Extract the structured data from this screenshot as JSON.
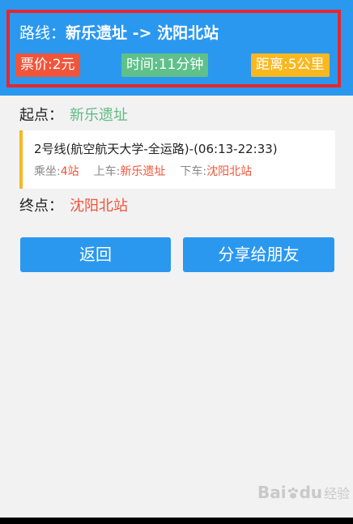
{
  "route": {
    "label": "路线：",
    "from": "新乐遗址",
    "arrow": " -> ",
    "to": "沈阳北站"
  },
  "badges": {
    "price": "票价:2元",
    "time": "时间:11分钟",
    "distance": "距离:5公里"
  },
  "start": {
    "label": "起点：",
    "value": "新乐遗址"
  },
  "segment": {
    "title": "2号线(航空航天大学-全运路)-(06:13-22:33)",
    "ride_label": "乘坐:",
    "ride_value": "4站",
    "board_label": "上车:",
    "board_value": "新乐遗址",
    "alight_label": "下车:",
    "alight_value": "沈阳北站"
  },
  "end": {
    "label": "终点：",
    "value": "沈阳北站"
  },
  "buttons": {
    "back": "返回",
    "share": "分享给朋友"
  },
  "watermark": {
    "brand_a": "Bai",
    "brand_b": "du",
    "sub": "经验"
  },
  "colors": {
    "header_bg": "#2b98f0",
    "highlight_border": "#e8262c",
    "price_badge": "#f0553a",
    "time_badge": "#5fc08a",
    "distance_badge": "#f9b820",
    "start_green": "#5fbb86",
    "accent_orange": "#f0553a"
  }
}
